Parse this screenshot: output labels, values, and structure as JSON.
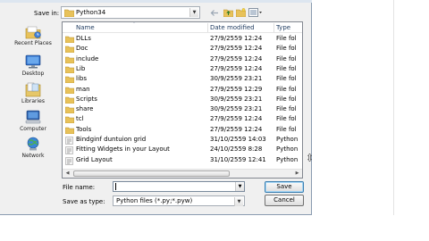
{
  "dialog": {
    "save_in_label": "Save in:",
    "save_in_value": "Python34"
  },
  "toolbar": {
    "icons": [
      "back-arrow-icon",
      "up-folder-icon",
      "new-folder-icon",
      "views-menu-icon"
    ]
  },
  "places": [
    {
      "label": "Recent Places",
      "icon": "recent-places-icon"
    },
    {
      "label": "Desktop",
      "icon": "desktop-icon"
    },
    {
      "label": "Libraries",
      "icon": "libraries-icon"
    },
    {
      "label": "Computer",
      "icon": "computer-icon"
    },
    {
      "label": "Network",
      "icon": "network-icon"
    }
  ],
  "columns": {
    "name": "Name",
    "date": "Date modified",
    "type": "Type"
  },
  "files": [
    {
      "name": "DLLs",
      "date": "27/9/2559 12:24",
      "type": "File fol",
      "icon": "folder-icon"
    },
    {
      "name": "Doc",
      "date": "27/9/2559 12:24",
      "type": "File fol",
      "icon": "folder-icon"
    },
    {
      "name": "include",
      "date": "27/9/2559 12:24",
      "type": "File fol",
      "icon": "folder-icon"
    },
    {
      "name": "Lib",
      "date": "27/9/2559 12:24",
      "type": "File fol",
      "icon": "folder-icon"
    },
    {
      "name": "libs",
      "date": "30/9/2559 23:21",
      "type": "File fol",
      "icon": "folder-icon"
    },
    {
      "name": "man",
      "date": "27/9/2559 12:29",
      "type": "File fol",
      "icon": "folder-icon"
    },
    {
      "name": "Scripts",
      "date": "30/9/2559 23:21",
      "type": "File fol",
      "icon": "folder-icon"
    },
    {
      "name": "share",
      "date": "30/9/2559 23:21",
      "type": "File fol",
      "icon": "folder-icon"
    },
    {
      "name": "tcl",
      "date": "27/9/2559 12:24",
      "type": "File fol",
      "icon": "folder-icon"
    },
    {
      "name": "Tools",
      "date": "27/9/2559 12:24",
      "type": "File fol",
      "icon": "folder-icon"
    },
    {
      "name": "Bindginf duntuion grid",
      "date": "31/10/2559 14:03",
      "type": "Python",
      "icon": "python-file-icon"
    },
    {
      "name": "Fitting Widgets in your Layout",
      "date": "24/10/2559 8:28",
      "type": "Python",
      "icon": "python-file-icon"
    },
    {
      "name": "Grid Layout",
      "date": "31/10/2559 12:41",
      "type": "Python",
      "icon": "python-file-icon"
    }
  ],
  "filename": {
    "label": "File name:",
    "value": ""
  },
  "save_as_type": {
    "label": "Save as type:",
    "value": "Python files (*.py;*.pyw)"
  },
  "buttons": {
    "save": "Save",
    "cancel": "Cancel"
  }
}
